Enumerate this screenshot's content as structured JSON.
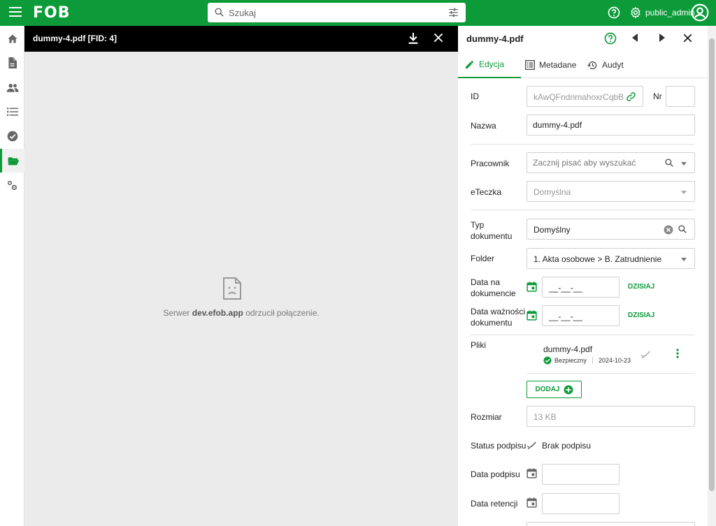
{
  "topbar": {
    "logo": "FOB",
    "search_placeholder": "Szukaj",
    "user": "public_admin"
  },
  "viewer": {
    "title": "dummy-4.pdf [FID: 4]",
    "error_prefix": "Serwer",
    "error_host": "dev.efob.app",
    "error_suffix": "odrzucił połączenie."
  },
  "panel": {
    "title": "dummy-4.pdf",
    "tabs": [
      {
        "label": "Edycja",
        "active": true
      },
      {
        "label": "Metadane",
        "active": false
      },
      {
        "label": "Audyt",
        "active": false
      }
    ],
    "fields": {
      "id_label": "ID",
      "id_value": "kAwQFndnmahoxrCqbB...",
      "nr_label": "Nr",
      "nazwa_label": "Nazwa",
      "nazwa_value": "dummy-4.pdf",
      "pracownik_label": "Pracownik",
      "pracownik_placeholder": "Zacznij pisać aby wyszukać",
      "eteczka_label": "eTeczka",
      "eteczka_value": "Domyślna",
      "typ_label": "Typ dokumentu",
      "typ_value": "Domyślny",
      "folder_label": "Folder",
      "folder_value": "1. Akta osobowe > B. Zatrudnienie",
      "data_dok_label": "Data na dokumencie",
      "data_dok_value": "__-__-__",
      "data_waz_label": "Data ważności dokumentu",
      "data_waz_value": "__-__-__",
      "today_label": "DZISIAJ",
      "pliki_label": "Pliki",
      "file_name": "dummy-4.pdf",
      "file_safe": "Bezpieczny",
      "file_date": "2024-10-23",
      "add_label": "DODAJ",
      "rozmiar_label": "Rozmiar",
      "rozmiar_value": "13 KB",
      "status_label": "Status podpisu",
      "status_value": "Brak podpisu",
      "data_podpisu_label": "Data podpisu",
      "data_retencji_label": "Data retencji"
    }
  },
  "colors": {
    "brand": "#0d9b3a",
    "viewer_header": "#000000",
    "viewer_bg": "#ebebeb"
  }
}
